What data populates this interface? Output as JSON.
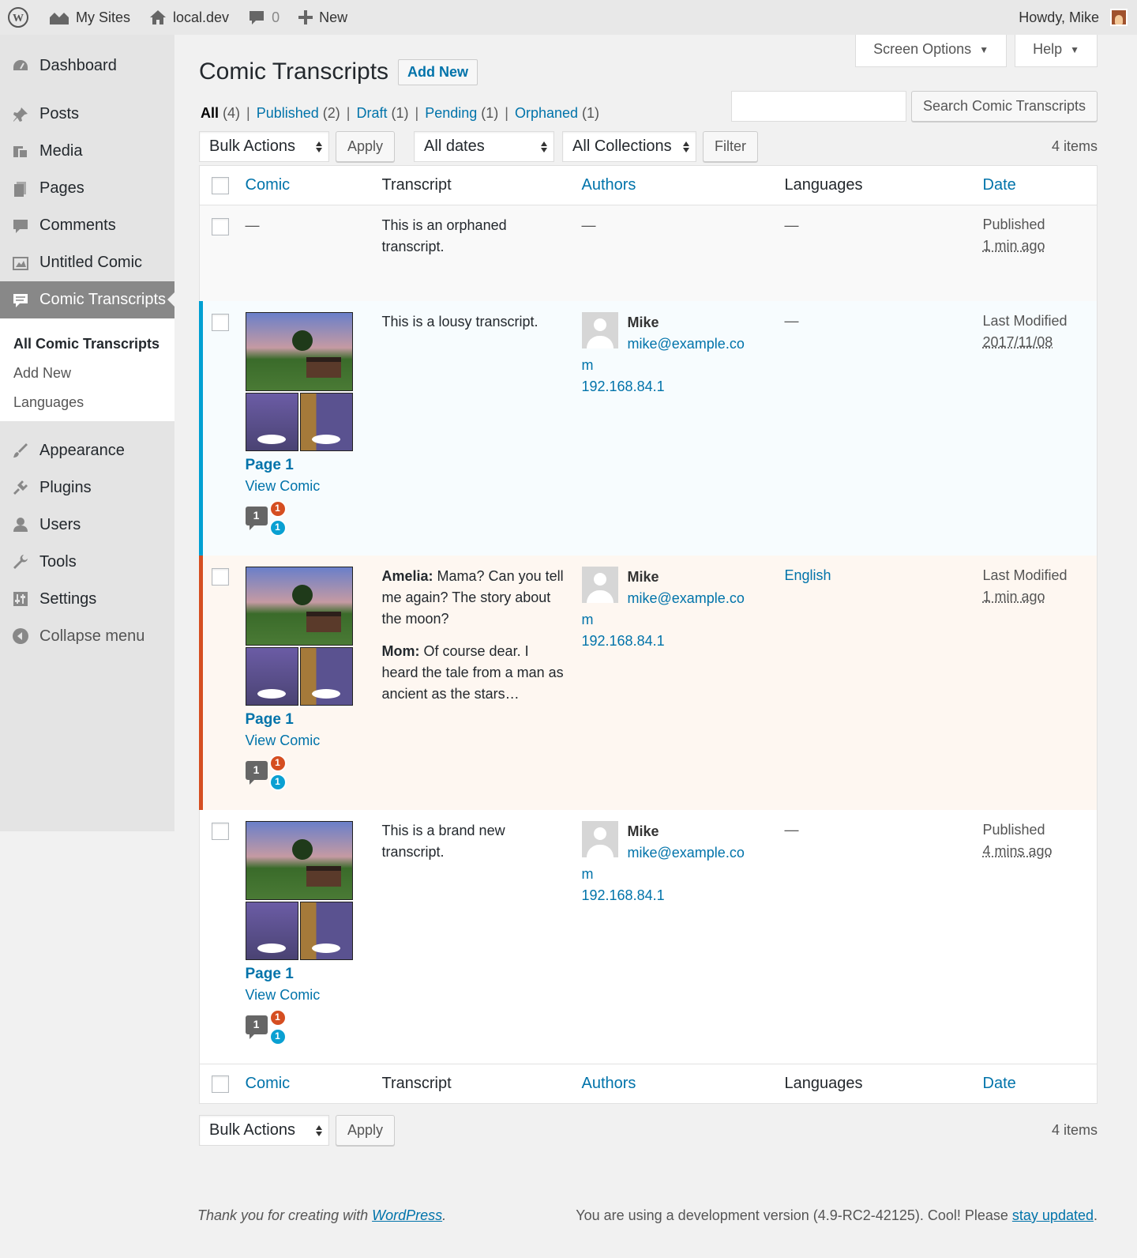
{
  "adminbar": {
    "my_sites": "My Sites",
    "site": "local.dev",
    "comments_count": "0",
    "new": "New",
    "howdy": "Howdy, Mike"
  },
  "sidebar": {
    "items": [
      {
        "label": "Dashboard",
        "icon": "dashboard-icon"
      },
      {
        "label": "Posts",
        "icon": "pin-icon"
      },
      {
        "label": "Media",
        "icon": "media-icon"
      },
      {
        "label": "Pages",
        "icon": "pages-icon"
      },
      {
        "label": "Comments",
        "icon": "comment-icon"
      },
      {
        "label": "Untitled Comic",
        "icon": "comic-icon"
      },
      {
        "label": "Comic Transcripts",
        "icon": "transcript-icon"
      },
      {
        "label": "Appearance",
        "icon": "brush-icon"
      },
      {
        "label": "Plugins",
        "icon": "plug-icon"
      },
      {
        "label": "Users",
        "icon": "user-icon"
      },
      {
        "label": "Tools",
        "icon": "wrench-icon"
      },
      {
        "label": "Settings",
        "icon": "sliders-icon"
      },
      {
        "label": "Collapse menu",
        "icon": "collapse-icon"
      }
    ],
    "submenu": [
      "All Comic Transcripts",
      "Add New",
      "Languages"
    ]
  },
  "header": {
    "screen_options": "Screen Options",
    "help": "Help",
    "title": "Comic Transcripts",
    "add_new": "Add New"
  },
  "views": [
    {
      "label": "All",
      "count": "(4)"
    },
    {
      "label": "Published",
      "count": "(2)"
    },
    {
      "label": "Draft",
      "count": "(1)"
    },
    {
      "label": "Pending",
      "count": "(1)"
    },
    {
      "label": "Orphaned",
      "count": "(1)"
    }
  ],
  "search": {
    "button": "Search Comic Transcripts",
    "value": ""
  },
  "tablenav": {
    "bulk_actions": "Bulk Actions",
    "apply": "Apply",
    "dates": "All dates",
    "collections": "All Collections",
    "filter": "Filter",
    "items": "4 items"
  },
  "columns": {
    "comic": "Comic",
    "transcript": "Transcript",
    "authors": "Authors",
    "languages": "Languages",
    "date": "Date"
  },
  "rows": [
    {
      "comic_dash": "—",
      "transcript": "This is an orphaned transcript.",
      "authors_dash": "—",
      "language": "—",
      "date_status": "Published",
      "date_value": "1 min ago"
    },
    {
      "page": "Page 1",
      "view": "View Comic",
      "badge_total": "1",
      "badge_red": "1",
      "badge_blue": "1",
      "transcript": "This is a lousy transcript.",
      "author_name": "Mike",
      "author_email_a": "mike@example.co",
      "author_email_b": "m",
      "author_ip": "192.168.84.1",
      "language": "—",
      "date_status": "Last Modified",
      "date_value": "2017/11/08",
      "stripe_color": "#00a0d2"
    },
    {
      "page": "Page 1",
      "view": "View Comic",
      "badge_total": "1",
      "badge_red": "1",
      "badge_blue": "1",
      "line1_speaker": "Amelia:",
      "line1_text": " Mama? Can you tell me again? The story about the moon?",
      "line2_speaker": "Mom:",
      "line2_text": " Of course dear. I heard the tale from a man as ancient as the stars…",
      "author_name": "Mike",
      "author_email_a": "mike@example.co",
      "author_email_b": "m",
      "author_ip": "192.168.84.1",
      "language": "English",
      "date_status": "Last Modified",
      "date_value": "1 min ago",
      "stripe_color": "#d54e21"
    },
    {
      "page": "Page 1",
      "view": "View Comic",
      "badge_total": "1",
      "badge_red": "1",
      "badge_blue": "1",
      "transcript": "This is a brand new transcript.",
      "author_name": "Mike",
      "author_email_a": "mike@example.co",
      "author_email_b": "m",
      "author_ip": "192.168.84.1",
      "language": "—",
      "date_status": "Published",
      "date_value": "4 mins ago"
    }
  ],
  "footer": {
    "thanks_prefix": "Thank you for creating with ",
    "wordpress": "WordPress",
    "thanks_suffix": ".",
    "version_prefix": "You are using a development version (4.9-RC2-42125). Cool! Please ",
    "stay_updated": "stay updated",
    "version_suffix": "."
  }
}
